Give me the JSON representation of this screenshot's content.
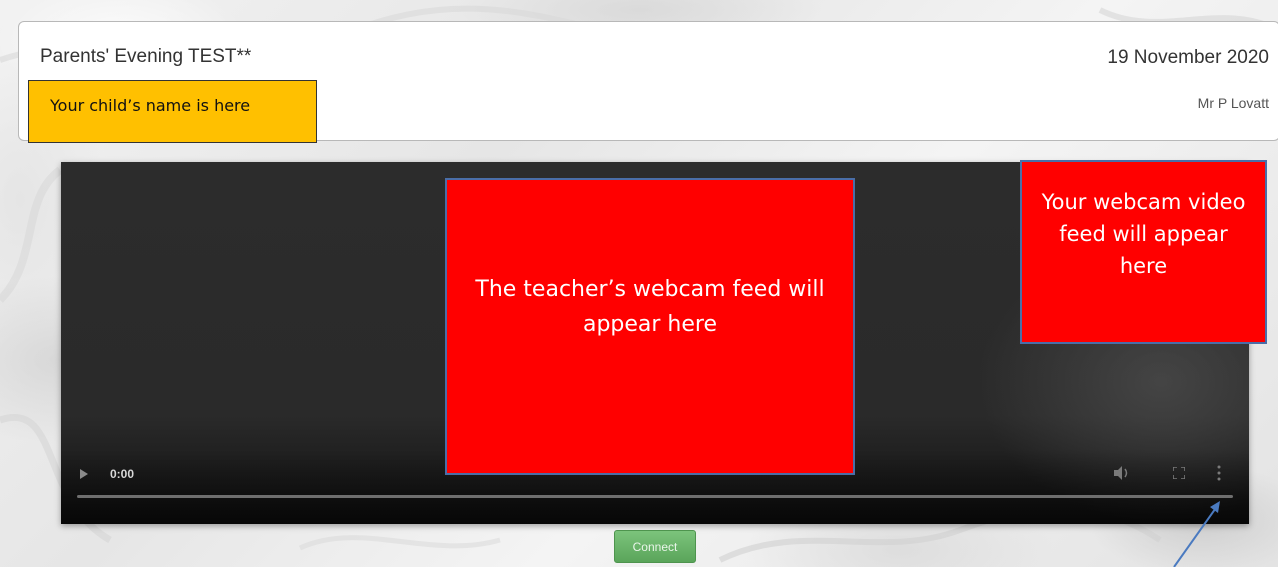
{
  "header": {
    "event_title": "Parents' Evening TEST**",
    "event_date": "19 November 2020",
    "teacher_name": "Mr P Lovatt"
  },
  "callouts": {
    "child_name": "Your child’s name is here",
    "teacher_feed": "The teacher’s webcam feed will appear here",
    "own_feed": "Your webcam video feed will appear here"
  },
  "player": {
    "time": "0:00",
    "progress": 0,
    "icons": [
      "play-icon",
      "volume-icon",
      "fullscreen-icon",
      "more-options-icon"
    ]
  },
  "actions": {
    "connect_label": "Connect"
  },
  "colors": {
    "callout_yellow": "#ffc000",
    "callout_red": "#ff0000",
    "callout_border": "#4a6ea8",
    "connect_green": "#5aa55a",
    "player_bg": "#2a2a2a"
  }
}
